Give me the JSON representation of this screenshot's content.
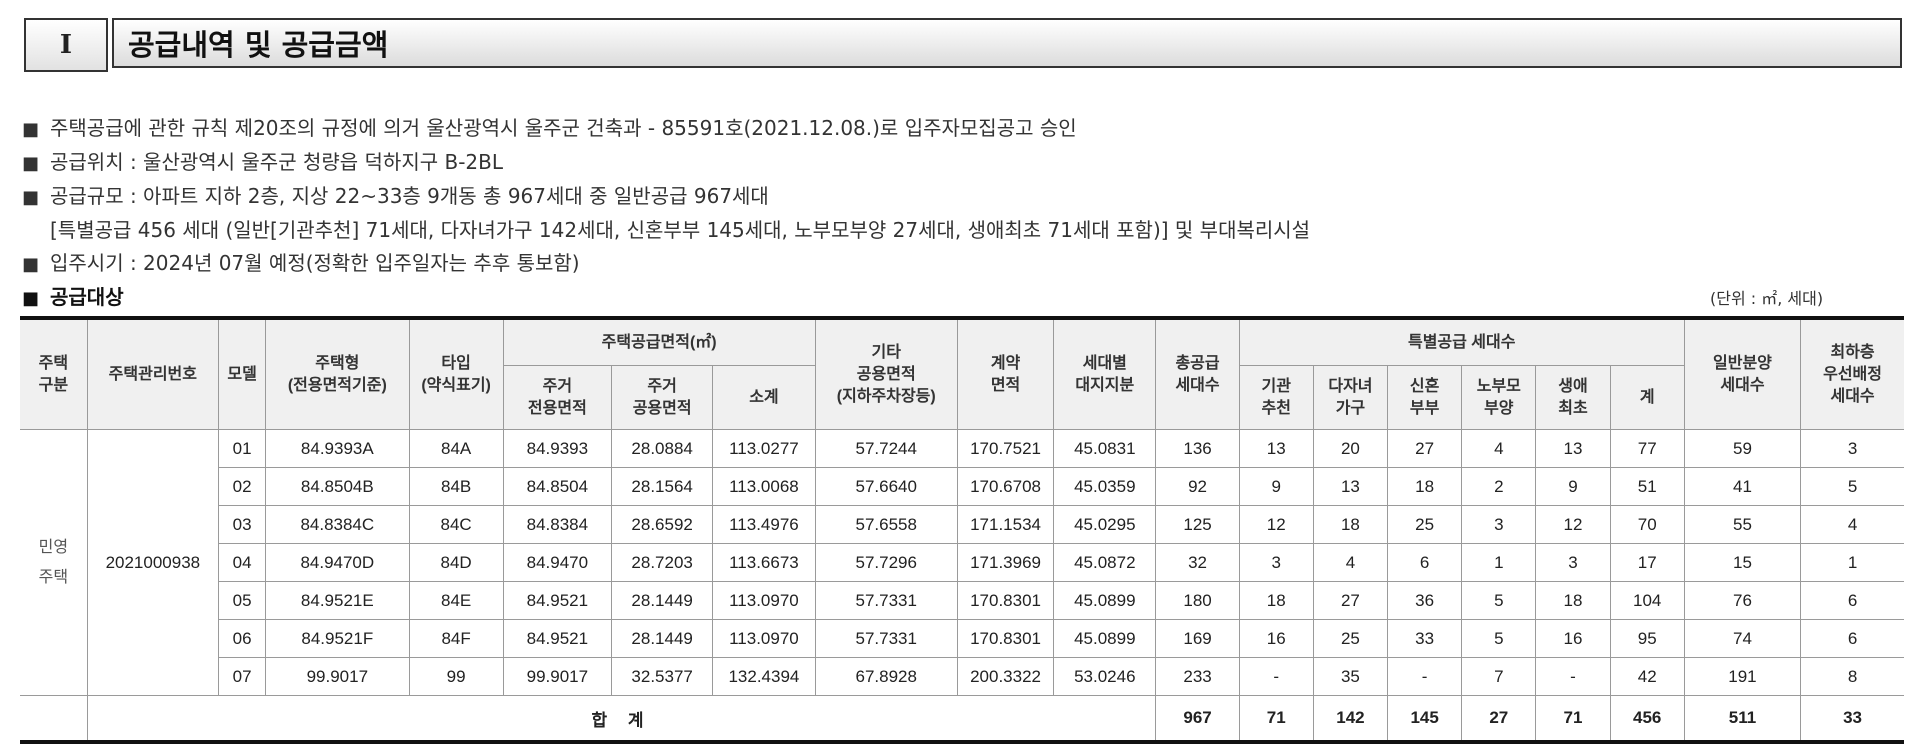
{
  "header": {
    "section_number": "I",
    "title": "공급내역 및 공급금액"
  },
  "notes": [
    "주택공급에 관한 규칙 제20조의 규정에 의거 울산광역시 울주군 건축과 - 85591호(2021.12.08.)로 입주자모집공고 승인",
    "공급위치 : 울산광역시 울주군 청량읍 덕하지구 B-2BL",
    "공급규모 : 아파트 지하 2층, 지상 22~33층 9개동 총 967세대 중 일반공급 967세대",
    "[특별공급 456 세대 (일반[기관추천] 71세대, 다자녀가구 142세대, 신혼부부 145세대, 노부모부양 27세대, 생애최초 71세대 포함)] 및 부대복리시설",
    "입주시기 : 2024년 07월 예정(정확한 입주일자는 추후 통보함)"
  ],
  "supply_target_heading": "공급대상",
  "unit_label": "(단위 : ㎡, 세대)",
  "table": {
    "headers": {
      "housing_type": "주택\n구분",
      "mgmt_no": "주택관리번호",
      "model": "모델",
      "house_type": "주택형\n(전용면적기준)",
      "type_abbr": "타입\n(약식표기)",
      "supply_area_group": "주택공급면적(㎡)",
      "exclusive_area": "주거\n전용면적",
      "common_area": "주거\n공용면적",
      "subtotal": "소계",
      "other_common": "기타\n공용면적\n(지하주차장등)",
      "contract_area": "계약\n면적",
      "land_share": "세대별\n대지지분",
      "total_supply": "총공급\n세대수",
      "special_group": "특별공급 세대수",
      "agency": "기관\n추천",
      "multi_child": "다자녀\n가구",
      "newlywed": "신혼\n부부",
      "elderly": "노부모\n부양",
      "first_life": "생애\n최초",
      "special_total": "계",
      "general": "일반분양\n세대수",
      "lowest_floor": "최하층\n우선배정\n세대수"
    },
    "housing_category": "민영\n주택",
    "management_number": "2021000938",
    "rows": [
      [
        "01",
        "84.9393A",
        "84A",
        "84.9393",
        "28.0884",
        "113.0277",
        "57.7244",
        "170.7521",
        "45.0831",
        "136",
        "13",
        "20",
        "27",
        "4",
        "13",
        "77",
        "59",
        "3"
      ],
      [
        "02",
        "84.8504B",
        "84B",
        "84.8504",
        "28.1564",
        "113.0068",
        "57.6640",
        "170.6708",
        "45.0359",
        "92",
        "9",
        "13",
        "18",
        "2",
        "9",
        "51",
        "41",
        "5"
      ],
      [
        "03",
        "84.8384C",
        "84C",
        "84.8384",
        "28.6592",
        "113.4976",
        "57.6558",
        "171.1534",
        "45.0295",
        "125",
        "12",
        "18",
        "25",
        "3",
        "12",
        "70",
        "55",
        "4"
      ],
      [
        "04",
        "84.9470D",
        "84D",
        "84.9470",
        "28.7203",
        "113.6673",
        "57.7296",
        "171.3969",
        "45.0872",
        "32",
        "3",
        "4",
        "6",
        "1",
        "3",
        "17",
        "15",
        "1"
      ],
      [
        "05",
        "84.9521E",
        "84E",
        "84.9521",
        "28.1449",
        "113.0970",
        "57.7331",
        "170.8301",
        "45.0899",
        "180",
        "18",
        "27",
        "36",
        "5",
        "18",
        "104",
        "76",
        "6"
      ],
      [
        "06",
        "84.9521F",
        "84F",
        "84.9521",
        "28.1449",
        "113.0970",
        "57.7331",
        "170.8301",
        "45.0899",
        "169",
        "16",
        "25",
        "33",
        "5",
        "16",
        "95",
        "74",
        "6"
      ],
      [
        "07",
        "99.9017",
        "99",
        "99.9017",
        "32.5377",
        "132.4394",
        "67.8928",
        "200.3322",
        "53.0246",
        "233",
        "-",
        "35",
        "-",
        "7",
        "-",
        "42",
        "191",
        "8"
      ]
    ],
    "total": {
      "label": "합 계",
      "values": [
        "967",
        "71",
        "142",
        "145",
        "27",
        "71",
        "456",
        "511",
        "33"
      ]
    }
  }
}
